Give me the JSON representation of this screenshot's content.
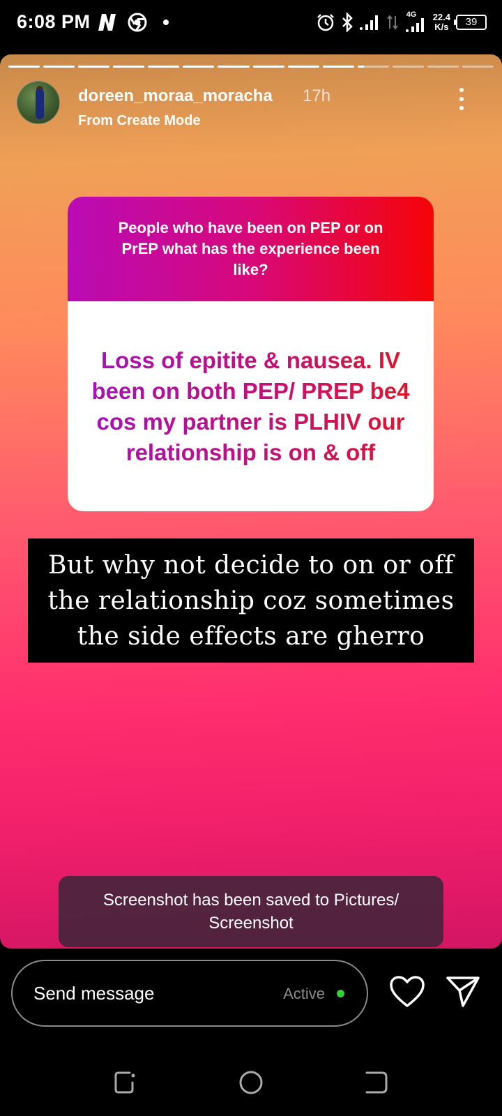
{
  "status_bar": {
    "time": "6:08 PM",
    "network_type": "4G",
    "speed_value": "22.4",
    "speed_unit": "K/s",
    "battery": "39"
  },
  "story": {
    "segments_total": 14,
    "segments_complete": 10,
    "current_segment_progress": 0.2,
    "username": "doreen_moraa_moracha",
    "time_ago": "17h",
    "subtitle": "From Create Mode",
    "question": "People who have been on PEP or on PrEP what has the experience been like?",
    "answer": "Loss of epitite & nausea. IV been on both PEP/ PREP be4 cos my partner is PLHIV our relationship is on & off",
    "caption": "But why not decide to on or off the relationship coz sometimes the side effects are gherro"
  },
  "toast": {
    "message": "Screenshot has been saved to  Pictures/ Screenshot"
  },
  "message_bar": {
    "placeholder": "Send message",
    "status": "Active"
  },
  "icons": {
    "like": "heart-icon",
    "share": "send-icon",
    "more": "more-vertical-icon"
  },
  "colors": {
    "question_gradient_start": "#b90bb5",
    "question_gradient_end": "#f50506",
    "active_dot": "#2fd32f"
  }
}
